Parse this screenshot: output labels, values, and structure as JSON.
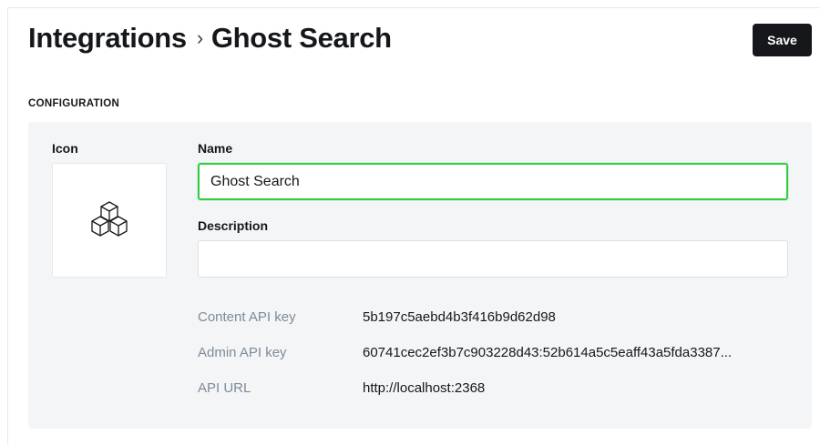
{
  "breadcrumb": {
    "parent": "Integrations",
    "separator": "›",
    "current": "Ghost Search"
  },
  "header": {
    "save_label": "Save"
  },
  "section": {
    "label": "CONFIGURATION"
  },
  "icon": {
    "label": "Icon",
    "name": "cubes-icon"
  },
  "fields": {
    "name": {
      "label": "Name",
      "value": "Ghost Search",
      "placeholder": ""
    },
    "description": {
      "label": "Description",
      "value": "",
      "placeholder": ""
    }
  },
  "api": {
    "content_key": {
      "label": "Content API key",
      "value": "5b197c5aebd4b3f416b9d62d98"
    },
    "admin_key": {
      "label": "Admin API key",
      "value": "60741cec2ef3b7c903228d43:52b614a5c5eaff43a5fda3387..."
    },
    "url": {
      "label": "API URL",
      "value": "http://localhost:2368"
    }
  },
  "colors": {
    "focus_border": "#30cf43",
    "panel_bg": "#f4f5f6",
    "button_bg": "#15171a",
    "muted_text": "#7c8b9a"
  }
}
